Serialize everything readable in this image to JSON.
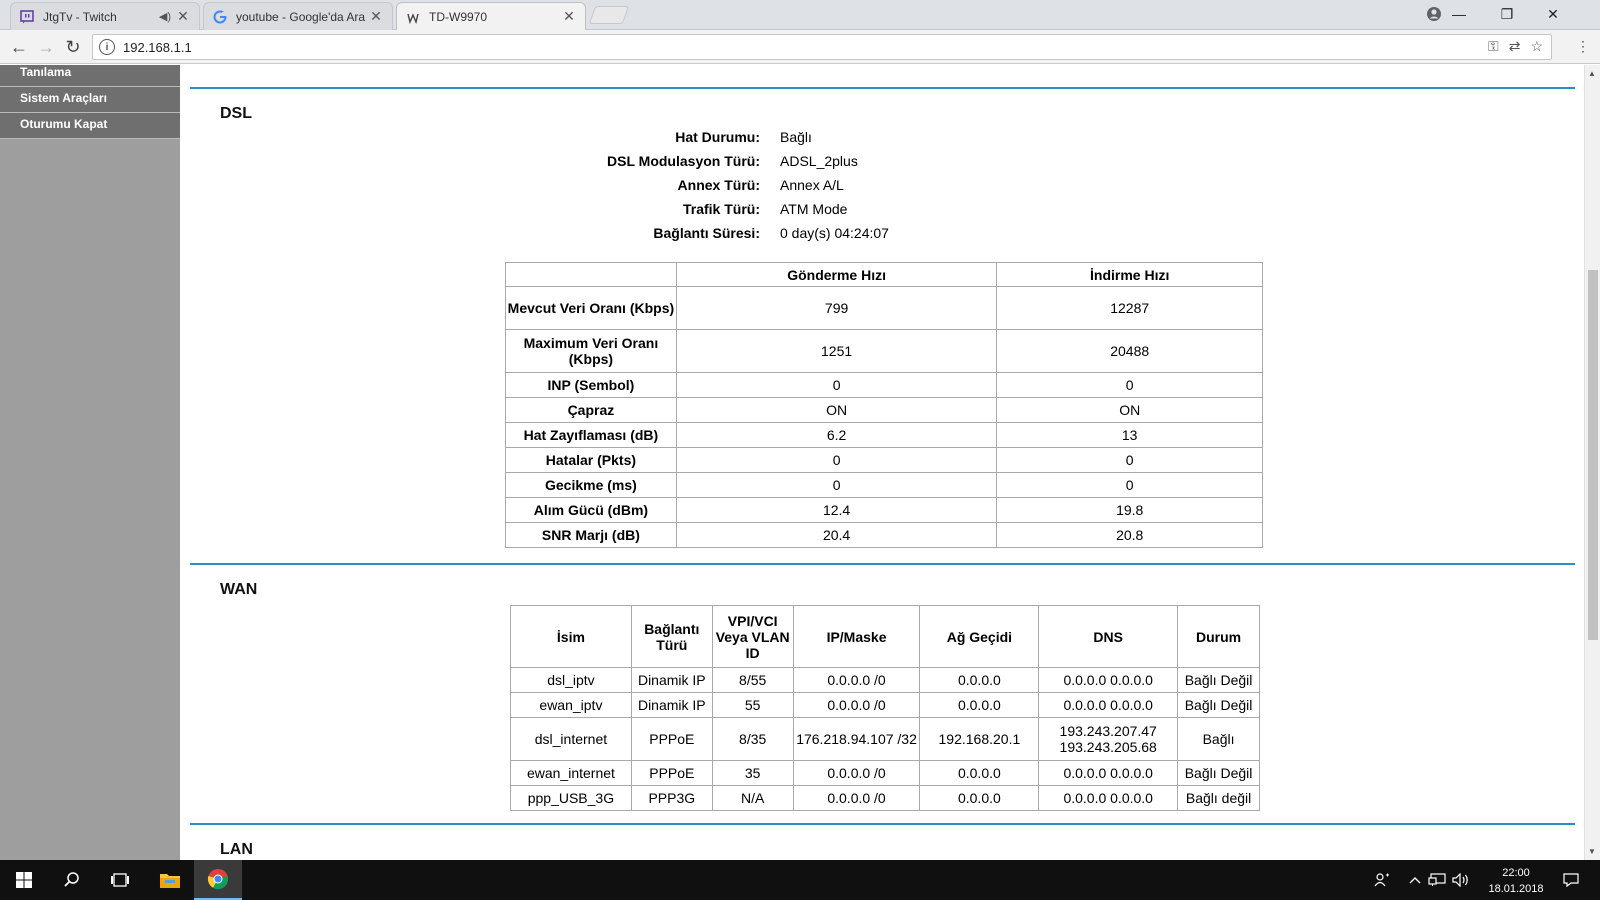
{
  "browser": {
    "tabs": [
      {
        "label": "JtgTv - Twitch",
        "icon": "twitch-icon"
      },
      {
        "label": "youtube - Google'da Ara",
        "icon": "google-icon"
      },
      {
        "label": "TD-W9970",
        "icon": "tplink-icon"
      }
    ],
    "url": "192.168.1.1"
  },
  "sidebar": {
    "items": [
      {
        "label": "Tanılama"
      },
      {
        "label": "Sistem Araçları"
      },
      {
        "label": "Oturumu Kapat"
      }
    ]
  },
  "dsl": {
    "title": "DSL",
    "fields": [
      {
        "key": "Hat Durumu:",
        "value": "Bağlı"
      },
      {
        "key": "DSL Modulasyon Türü:",
        "value": "ADSL_2plus"
      },
      {
        "key": "Annex Türü:",
        "value": "Annex A/L"
      },
      {
        "key": "Trafik Türü:",
        "value": "ATM Mode"
      },
      {
        "key": "Bağlantı Süresi:",
        "value": "0 day(s) 04:24:07"
      }
    ],
    "table": {
      "headers": [
        "",
        "Gönderme Hızı",
        "İndirme Hızı"
      ],
      "rows": [
        {
          "label": "Mevcut Veri Oranı (Kbps)",
          "up": "799",
          "down": "12287"
        },
        {
          "label": "Maximum Veri Oranı (Kbps)",
          "up": "1251",
          "down": "20488"
        },
        {
          "label": "INP (Sembol)",
          "up": "0",
          "down": "0"
        },
        {
          "label": "Çapraz",
          "up": "ON",
          "down": "ON"
        },
        {
          "label": "Hat Zayıflaması (dB)",
          "up": "6.2",
          "down": "13"
        },
        {
          "label": "Hatalar (Pkts)",
          "up": "0",
          "down": "0"
        },
        {
          "label": "Gecikme (ms)",
          "up": "0",
          "down": "0"
        },
        {
          "label": "Alım Gücü (dBm)",
          "up": "12.4",
          "down": "19.8"
        },
        {
          "label": "SNR Marjı (dB)",
          "up": "20.4",
          "down": "20.8"
        }
      ]
    }
  },
  "wan": {
    "title": "WAN",
    "headers": [
      "İsim",
      "Bağlantı Türü",
      "VPI/VCI Veya VLAN ID",
      "IP/Maske",
      "Ağ Geçidi",
      "DNS",
      "Durum"
    ],
    "rows": [
      {
        "name": "dsl_iptv",
        "type": "Dinamik IP",
        "vpi": "8/55",
        "ip": "0.0.0.0 /0",
        "gw": "0.0.0.0",
        "dns": "0.0.0.0 0.0.0.0",
        "status": "Bağlı Değil"
      },
      {
        "name": "ewan_iptv",
        "type": "Dinamik IP",
        "vpi": "55",
        "ip": "0.0.0.0 /0",
        "gw": "0.0.0.0",
        "dns": "0.0.0.0 0.0.0.0",
        "status": "Bağlı Değil"
      },
      {
        "name": "dsl_internet",
        "type": "PPPoE",
        "vpi": "8/35",
        "ip": "176.218.94.107 /32",
        "gw": "192.168.20.1",
        "dns": "193.243.207.47 193.243.205.68",
        "status": "Bağlı"
      },
      {
        "name": "ewan_internet",
        "type": "PPPoE",
        "vpi": "35",
        "ip": "0.0.0.0 /0",
        "gw": "0.0.0.0",
        "dns": "0.0.0.0 0.0.0.0",
        "status": "Bağlı Değil"
      },
      {
        "name": "ppp_USB_3G",
        "type": "PPP3G",
        "vpi": "N/A",
        "ip": "0.0.0.0 /0",
        "gw": "0.0.0.0",
        "dns": "0.0.0.0 0.0.0.0",
        "status": "Bağlı değil"
      }
    ]
  },
  "lan": {
    "title": "LAN"
  },
  "taskbar": {
    "time": "22:00",
    "date": "18.01.2018"
  },
  "colors": {
    "accent_line": "#2a8fc7",
    "sidebar_bg": "#9e9e9e",
    "menu_bg": "#6f6f6f"
  }
}
